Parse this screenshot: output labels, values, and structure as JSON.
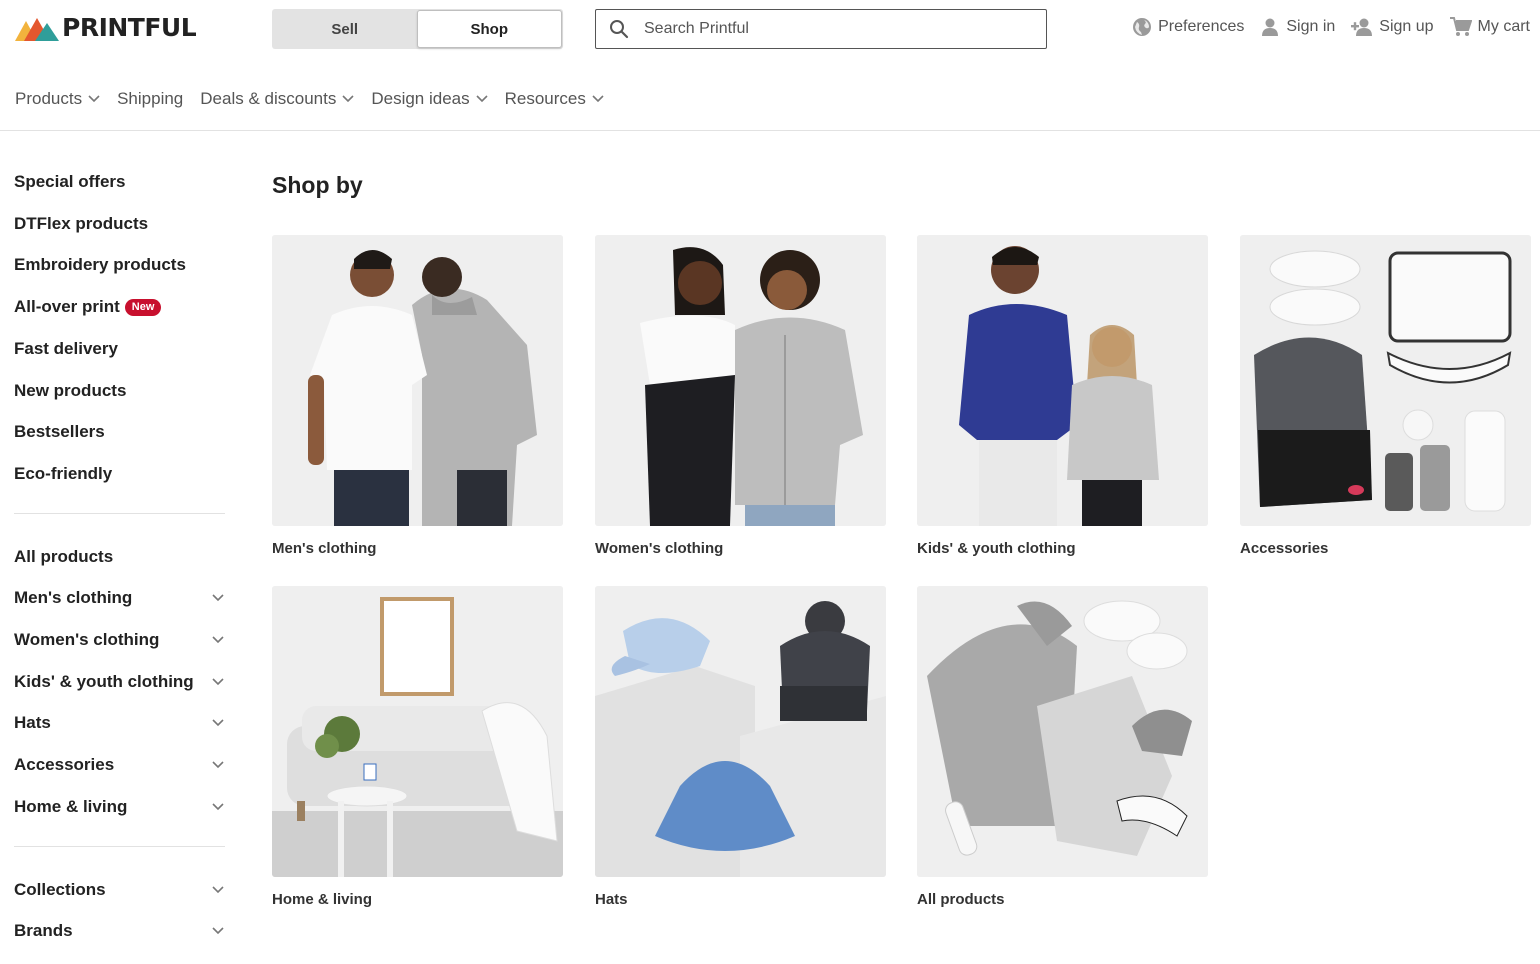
{
  "brand": {
    "name": "PRINTFUL"
  },
  "mode_switch": {
    "sell": "Sell",
    "shop": "Shop",
    "selected": "Shop"
  },
  "search": {
    "placeholder": "Search Printful"
  },
  "top_actions": {
    "preferences": "Preferences",
    "sign_in": "Sign in",
    "sign_up": "Sign up",
    "cart": "My cart"
  },
  "nav": {
    "products": "Products",
    "shipping": "Shipping",
    "deals": "Deals & discounts",
    "design_ideas": "Design ideas",
    "resources": "Resources"
  },
  "sidebar": {
    "featured": [
      {
        "label": "Special offers"
      },
      {
        "label": "DTFlex products"
      },
      {
        "label": "Embroidery products"
      },
      {
        "label": "All-over print",
        "badge": "New"
      },
      {
        "label": "Fast delivery"
      },
      {
        "label": "New products"
      },
      {
        "label": "Bestsellers"
      },
      {
        "label": "Eco-friendly"
      }
    ],
    "categories": [
      {
        "label": "All products"
      },
      {
        "label": "Men's clothing"
      },
      {
        "label": "Women's clothing"
      },
      {
        "label": "Kids' & youth clothing"
      },
      {
        "label": "Hats"
      },
      {
        "label": "Accessories"
      },
      {
        "label": "Home & living"
      }
    ],
    "more": [
      {
        "label": "Collections"
      },
      {
        "label": "Brands"
      }
    ]
  },
  "main": {
    "title": "Shop by",
    "cards": [
      {
        "label": "Men's clothing"
      },
      {
        "label": "Women's clothing"
      },
      {
        "label": "Kids' & youth clothing"
      },
      {
        "label": "Accessories"
      },
      {
        "label": "Home & living"
      },
      {
        "label": "Hats"
      },
      {
        "label": "All products"
      }
    ]
  },
  "colors": {
    "accent_red": "#c8102e",
    "logo_red": "#e4572e",
    "logo_teal": "#2f9e9a",
    "logo_yellow": "#f2b33d",
    "text_dark": "#222222",
    "text_muted": "#555555",
    "card_bg": "#efefef"
  },
  "icons": {
    "search": "search-icon",
    "preferences": "globe-icon",
    "sign_in": "user-icon",
    "sign_up": "add-user-icon",
    "cart": "cart-icon",
    "dropdown": "chevron-down-icon"
  }
}
